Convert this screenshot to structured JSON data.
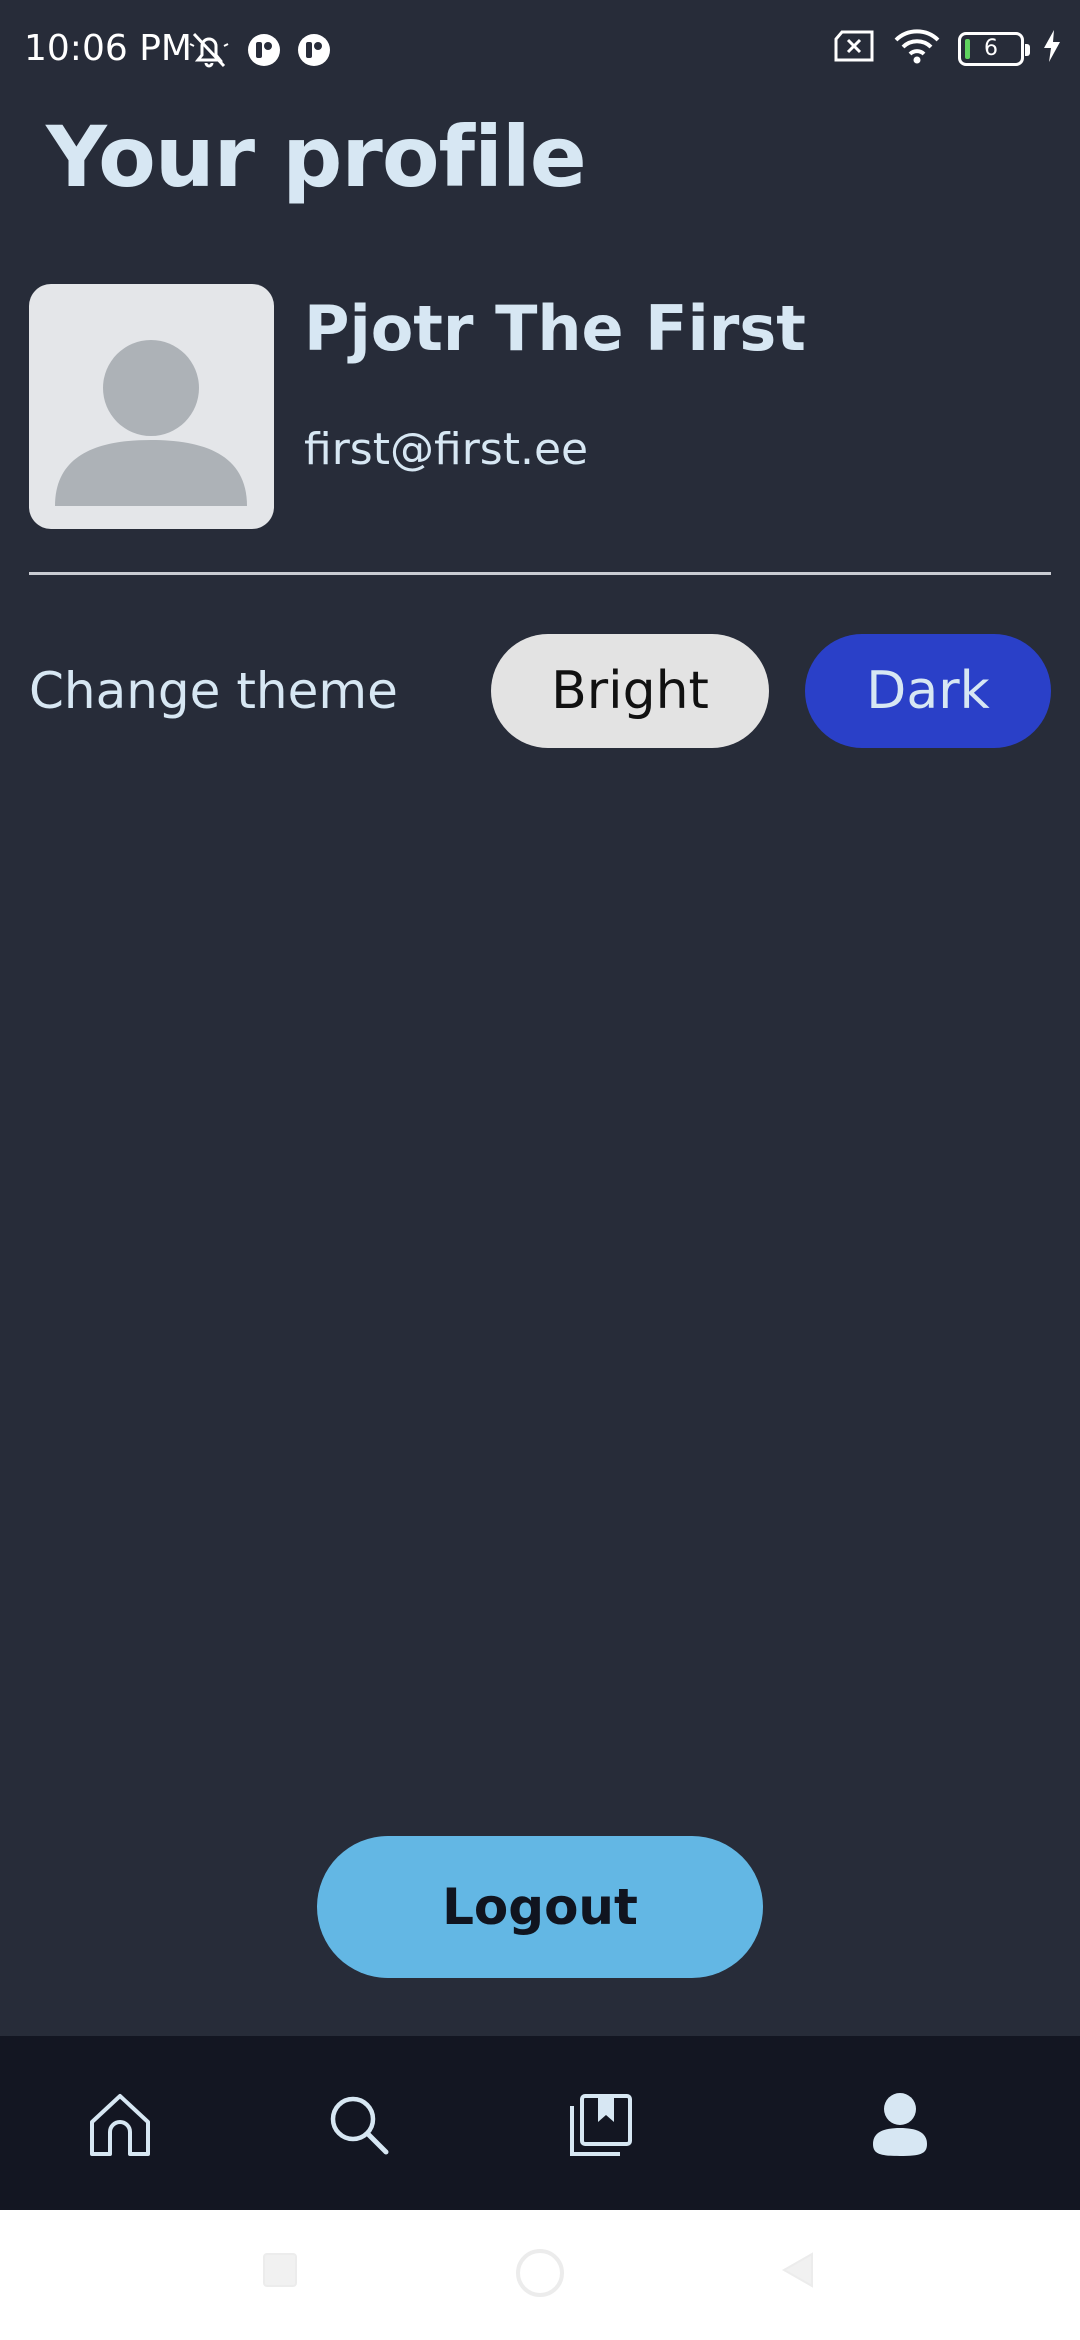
{
  "status_bar": {
    "time": "10:06 PM",
    "battery_level": "6",
    "icons": [
      "bell-off-icon",
      "app-notification-icon",
      "app-notification-icon",
      "sim-x-icon",
      "wifi-icon",
      "battery-icon",
      "charging-icon"
    ]
  },
  "page": {
    "title": "Your profile"
  },
  "profile": {
    "name": "Pjotr The First",
    "email": "first@first.ee",
    "avatar_icon": "person-placeholder-icon"
  },
  "theme": {
    "label": "Change theme",
    "bright_label": "Bright",
    "dark_label": "Dark",
    "selected": "Dark"
  },
  "actions": {
    "logout_label": "Logout"
  },
  "bottom_nav": {
    "items": [
      "home-icon",
      "search-icon",
      "bookmarks-icon",
      "profile-icon"
    ],
    "active": "profile-icon"
  },
  "colors": {
    "background": "#272c39",
    "text": "#d7e7f3",
    "dark_button": "#2a40c8",
    "bright_button": "#e3e3e3",
    "logout_button": "#63b7e4",
    "nav_background": "#131622"
  }
}
